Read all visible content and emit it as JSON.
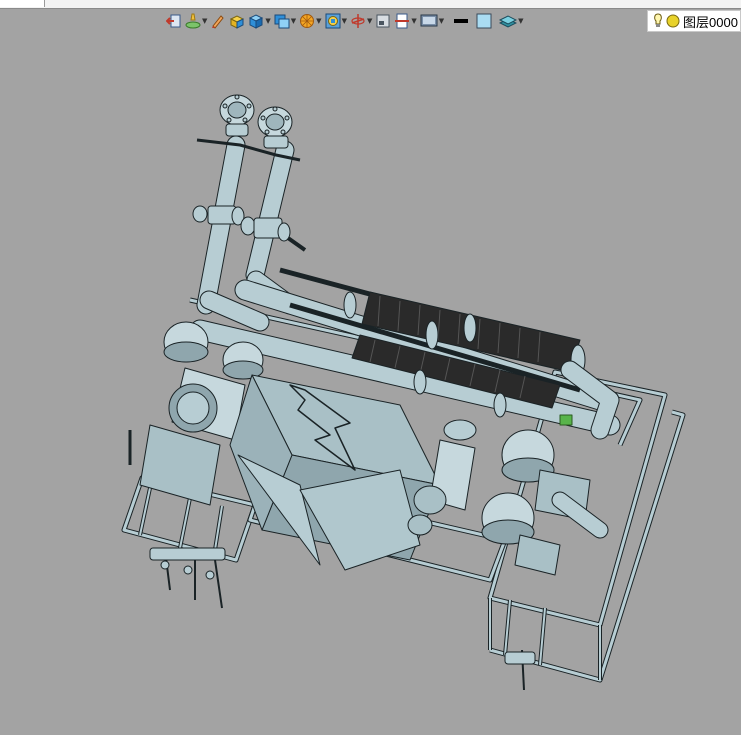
{
  "app": {
    "layer_selector": {
      "label": "图层0000",
      "icons": [
        "lightbulb-icon",
        "layer-color-icon"
      ]
    }
  },
  "toolbar": {
    "tools": [
      {
        "icon": "exit-sketch-icon",
        "dropdown": false
      },
      {
        "icon": "lighting-icon",
        "dropdown": true
      },
      {
        "icon": "edit-pencil-icon",
        "dropdown": false
      },
      {
        "icon": "shaded-solid-icon",
        "dropdown": false
      },
      {
        "icon": "view-cube-icon",
        "dropdown": true
      },
      {
        "icon": "display-mode-icon",
        "dropdown": true
      },
      {
        "icon": "render-sphere-icon",
        "dropdown": true
      },
      {
        "icon": "perspective-icon",
        "dropdown": true
      },
      {
        "icon": "rotate-axis-icon",
        "dropdown": true
      },
      {
        "icon": "graphics-properties-icon",
        "dropdown": false
      },
      {
        "icon": "section-view-icon",
        "dropdown": true
      },
      {
        "icon": "screen-display-icon",
        "dropdown": true
      },
      {
        "icon": "line-weight-icon",
        "dropdown": false
      },
      {
        "icon": "fill-color-icon",
        "dropdown": false
      },
      {
        "icon": "layers-stack-icon",
        "dropdown": true
      }
    ]
  },
  "colors": {
    "background": "#a3a3a3",
    "model_fill": "#b7cdd3",
    "model_shade": "#8fa6ad",
    "model_line": "#1a2326",
    "heater_dark": "#2a2a2a",
    "accent_green": "#58b44a"
  }
}
